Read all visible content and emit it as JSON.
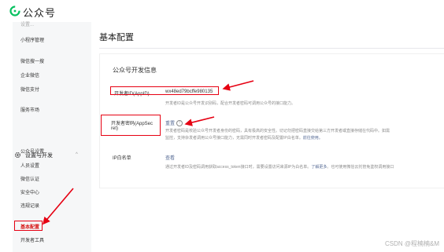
{
  "header": {
    "brand": "公众号"
  },
  "sidebar": {
    "cut_item": "设置...",
    "items": [
      {
        "label": "小程序管理"
      },
      {
        "label": "微信搜一搜"
      },
      {
        "label": "企业微信"
      },
      {
        "label": "微信支付"
      },
      {
        "label": "服务市场"
      }
    ],
    "group": {
      "label": "设置与开发",
      "chevron": "^"
    },
    "sub_items": [
      {
        "label": "公众号设置"
      },
      {
        "label": "人员设置"
      },
      {
        "label": "微信认证"
      },
      {
        "label": "安全中心"
      },
      {
        "label": "违规记录"
      },
      {
        "label": "基本配置"
      },
      {
        "label": "开发者工具"
      }
    ]
  },
  "main": {
    "title": "基本配置",
    "section_title": "公众号开发信息",
    "rows": [
      {
        "label": "开发者ID(AppID)",
        "value": "wx48ed79bcffe980135",
        "hint": "开发者ID是公众号开发识别码，配合开发者密码可调用公众号的接口能力。"
      },
      {
        "label": "开发者密码(AppSecret)",
        "label_line1": "开发者密码(AppSec",
        "label_line2": "ret)",
        "value": "重置",
        "hint1": "开发者密码是校验公众号开发者身份的密码，具有极高的安全性。切记勿把密码直接交给第三方开发者或直接存储在代码中。如需",
        "hint2": "监控，支持杂发者调用公众号接口能力，无需同时开发者密码及配置IP白名单。",
        "hint2_link": "前往使用。"
      },
      {
        "label": "IP白名单",
        "value": "查看",
        "hint": "通过开发者ID及密码调用获取access_token接口时，需要设置访问来源IP为白名单。",
        "hint_link": "了解更多",
        "hint_tail": "。也可使用微信云托管免鉴权调用接口"
      }
    ]
  },
  "watermark": "CSDN @程楠楠&M",
  "colors": {
    "annotation": "#e60012",
    "active": "#d71919",
    "link": "#576b95",
    "logo": "#07c160"
  }
}
